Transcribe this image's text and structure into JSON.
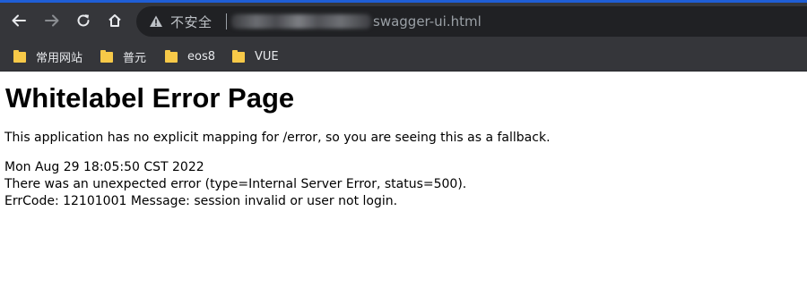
{
  "browser": {
    "security_label": "不安全",
    "url_path": "swagger-ui.html",
    "accent_color": "#1f5ed6",
    "icons": {
      "back": "arrow-left-icon",
      "forward": "arrow-right-icon",
      "reload": "reload-icon",
      "home": "home-icon",
      "security": "warning-triangle-icon"
    }
  },
  "bookmarks": [
    {
      "label": "常用网站",
      "icon": "folder-icon"
    },
    {
      "label": "普元",
      "icon": "folder-icon"
    },
    {
      "label": "eos8",
      "icon": "folder-icon"
    },
    {
      "label": "VUE",
      "icon": "folder-icon"
    }
  ],
  "page": {
    "title": "Whitelabel Error Page",
    "intro": "This application has no explicit mapping for /error, so you are seeing this as a fallback.",
    "timestamp": "Mon Aug 29 18:05:50 CST 2022",
    "error_line": "There was an unexpected error (type=Internal Server Error, status=500).",
    "message_line": "ErrCode: 12101001 Message: session invalid or user not login."
  }
}
